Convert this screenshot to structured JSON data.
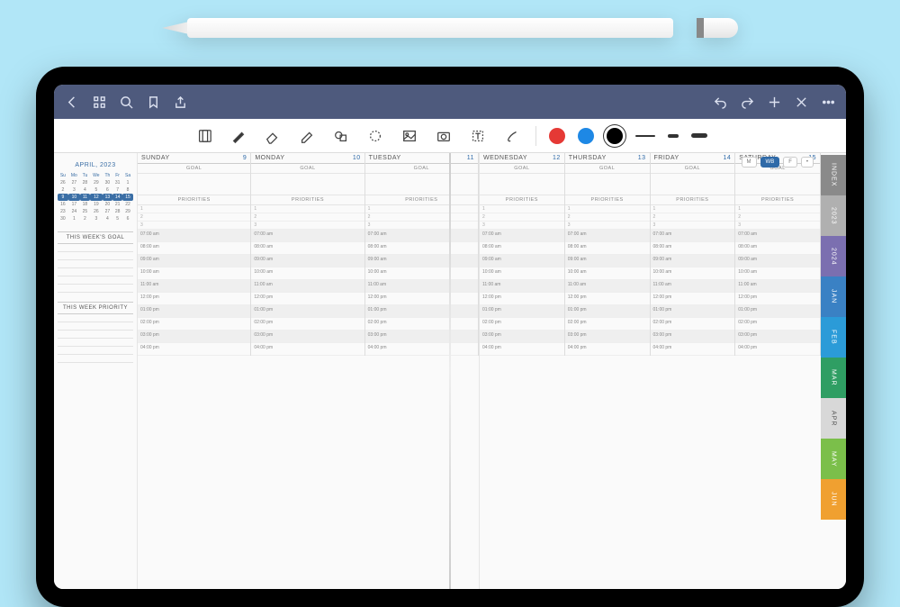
{
  "nav": {
    "icons": [
      "back",
      "apps",
      "search",
      "bookmark",
      "share",
      "undo",
      "redo",
      "add",
      "close",
      "more"
    ]
  },
  "toolbar": {
    "tools": [
      "notebook",
      "pen",
      "eraser",
      "highlighter",
      "shapes",
      "lasso",
      "image",
      "camera",
      "text",
      "brush"
    ],
    "colors": [
      "red",
      "blue",
      "black"
    ]
  },
  "view_pills": [
    "M",
    "WB",
    "F",
    "•"
  ],
  "view_active": 1,
  "sidebar": {
    "month": "APRIL, 2023",
    "dow": [
      "Su",
      "Mo",
      "Tu",
      "We",
      "Th",
      "Fr",
      "Sa"
    ],
    "grid": [
      [
        "26",
        "27",
        "28",
        "29",
        "30",
        "31",
        "1"
      ],
      [
        "2",
        "3",
        "4",
        "5",
        "6",
        "7",
        "8"
      ],
      [
        "9",
        "10",
        "11",
        "12",
        "13",
        "14",
        "15"
      ],
      [
        "16",
        "17",
        "18",
        "19",
        "20",
        "21",
        "22"
      ],
      [
        "23",
        "24",
        "25",
        "26",
        "27",
        "28",
        "29"
      ],
      [
        "30",
        "1",
        "2",
        "3",
        "4",
        "5",
        "6"
      ]
    ],
    "hl_row": 2,
    "goal_heading": "THIS WEEK'S GOAL",
    "priority_heading": "THIS WEEK PRIORITY"
  },
  "labels": {
    "goal": "GOAL",
    "priorities": "PRIORITIES"
  },
  "days_left": [
    {
      "name": "SUNDAY",
      "num": "9"
    },
    {
      "name": "MONDAY",
      "num": "10"
    },
    {
      "name": "TUESDAY",
      "num": "11"
    }
  ],
  "days_right": [
    {
      "name": "WEDNESDAY",
      "num": "12"
    },
    {
      "name": "THURSDAY",
      "num": "13"
    },
    {
      "name": "FRIDAY",
      "num": "14"
    },
    {
      "name": "SATURDAY",
      "num": "15"
    }
  ],
  "prio_nums": [
    "1",
    "2",
    "3"
  ],
  "times": [
    "07:00 am",
    "08:00 am",
    "09:00 am",
    "10:00 am",
    "11:00 am",
    "12:00 pm",
    "01:00 pm",
    "02:00 pm",
    "03:00 pm",
    "04:00 pm"
  ],
  "tabs": [
    {
      "label": "INDEX",
      "cls": "g0"
    },
    {
      "label": "2023",
      "cls": "g1"
    },
    {
      "label": "2024",
      "cls": "c0"
    },
    {
      "label": "JAN",
      "cls": "c1"
    },
    {
      "label": "FEB",
      "cls": "c2"
    },
    {
      "label": "MAR",
      "cls": "c3"
    },
    {
      "label": "APR",
      "cls": "c4"
    },
    {
      "label": "MAY",
      "cls": "c5"
    },
    {
      "label": "JUN",
      "cls": "c6"
    }
  ]
}
